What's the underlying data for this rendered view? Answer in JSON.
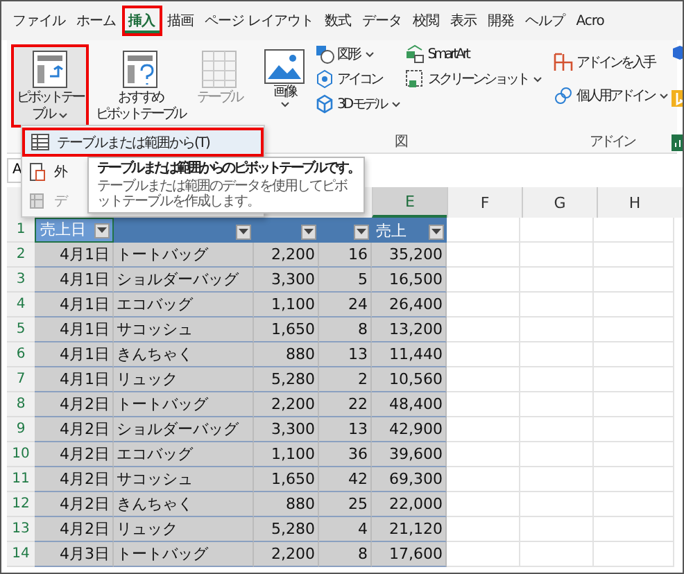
{
  "tabs": [
    {
      "label": "ファイル",
      "selected": false
    },
    {
      "label": "ホーム",
      "selected": false
    },
    {
      "label": "挿入",
      "selected": true
    },
    {
      "label": "描画",
      "selected": false
    },
    {
      "label": "ページ レイアウト",
      "selected": false
    },
    {
      "label": "数式",
      "selected": false
    },
    {
      "label": "データ",
      "selected": false
    },
    {
      "label": "校閲",
      "selected": false
    },
    {
      "label": "表示",
      "selected": false
    },
    {
      "label": "開発",
      "selected": false
    },
    {
      "label": "ヘルプ",
      "selected": false
    },
    {
      "label": "Acro",
      "selected": false
    }
  ],
  "table_group": [
    {
      "lines": [
        "ピボットテー",
        "ブル"
      ],
      "caret": true,
      "disabled": false,
      "highlighted": true
    },
    {
      "lines": [
        "おすすめ",
        "ピボットテーブル"
      ],
      "caret": false,
      "disabled": false,
      "highlighted": false
    },
    {
      "lines": [
        "テーブル"
      ],
      "caret": false,
      "disabled": true,
      "highlighted": false
    }
  ],
  "illustrations": {
    "big": {
      "label": "画像"
    },
    "items": [
      {
        "label": "図形",
        "caret": true
      },
      {
        "label": "アイコン",
        "caret": false
      },
      {
        "label": "3D モデル",
        "caret": true
      }
    ],
    "items2": [
      {
        "label": "SmartArt",
        "caret": false
      },
      {
        "label": "スクリーンショット",
        "caret": true
      }
    ],
    "group_label": "図"
  },
  "addins": {
    "items": [
      {
        "label": "アドインを入手",
        "caret": false
      },
      {
        "label": "個人用アドイン",
        "caret": true
      }
    ],
    "group_label": "アドイン"
  },
  "name_box": "A",
  "menu": [
    {
      "label": "テーブルまたは範囲から(T)",
      "disabled": false,
      "highlighted": true
    },
    {
      "label": "外",
      "disabled": false,
      "highlighted": false
    },
    {
      "label": "デ",
      "disabled": true,
      "highlighted": false
    }
  ],
  "tooltip": {
    "title": "テーブルまたは範囲からのピボットテーブルです。",
    "body": "テーブルまたは範囲のデータを使用してピボットテーブルを作成します。"
  },
  "column_letters": [
    "E",
    "F",
    "G",
    "H"
  ],
  "table": {
    "header_row_number": "1",
    "headers": [
      {
        "label": "売上日",
        "filter": true
      },
      {
        "filter": true
      },
      {
        "filter": true
      },
      {
        "filter": true
      },
      {
        "label": "売上",
        "filter": true
      }
    ],
    "rows": [
      [
        "2",
        "4月1日",
        "トートバッグ",
        "2,200",
        "16",
        "35,200"
      ],
      [
        "3",
        "4月1日",
        "ショルダーバッグ",
        "3,300",
        "5",
        "16,500"
      ],
      [
        "4",
        "4月1日",
        "エコバッグ",
        "1,100",
        "24",
        "26,400"
      ],
      [
        "5",
        "4月1日",
        "サコッシュ",
        "1,650",
        "8",
        "13,200"
      ],
      [
        "6",
        "4月1日",
        "きんちゃく",
        "880",
        "13",
        "11,440"
      ],
      [
        "7",
        "4月1日",
        "リュック",
        "5,280",
        "2",
        "10,560"
      ],
      [
        "8",
        "4月2日",
        "トートバッグ",
        "2,200",
        "22",
        "48,400"
      ],
      [
        "9",
        "4月2日",
        "ショルダーバッグ",
        "3,300",
        "13",
        "42,900"
      ],
      [
        "10",
        "4月2日",
        "エコバッグ",
        "1,100",
        "36",
        "39,600"
      ],
      [
        "11",
        "4月2日",
        "サコッシュ",
        "1,650",
        "42",
        "69,300"
      ],
      [
        "12",
        "4月2日",
        "きんちゃく",
        "880",
        "25",
        "22,000"
      ],
      [
        "13",
        "4月2日",
        "リュック",
        "5,280",
        "4",
        "21,120"
      ],
      [
        "14",
        "4月3日",
        "トートバッグ",
        "2,200",
        "8",
        "17,600"
      ]
    ]
  }
}
